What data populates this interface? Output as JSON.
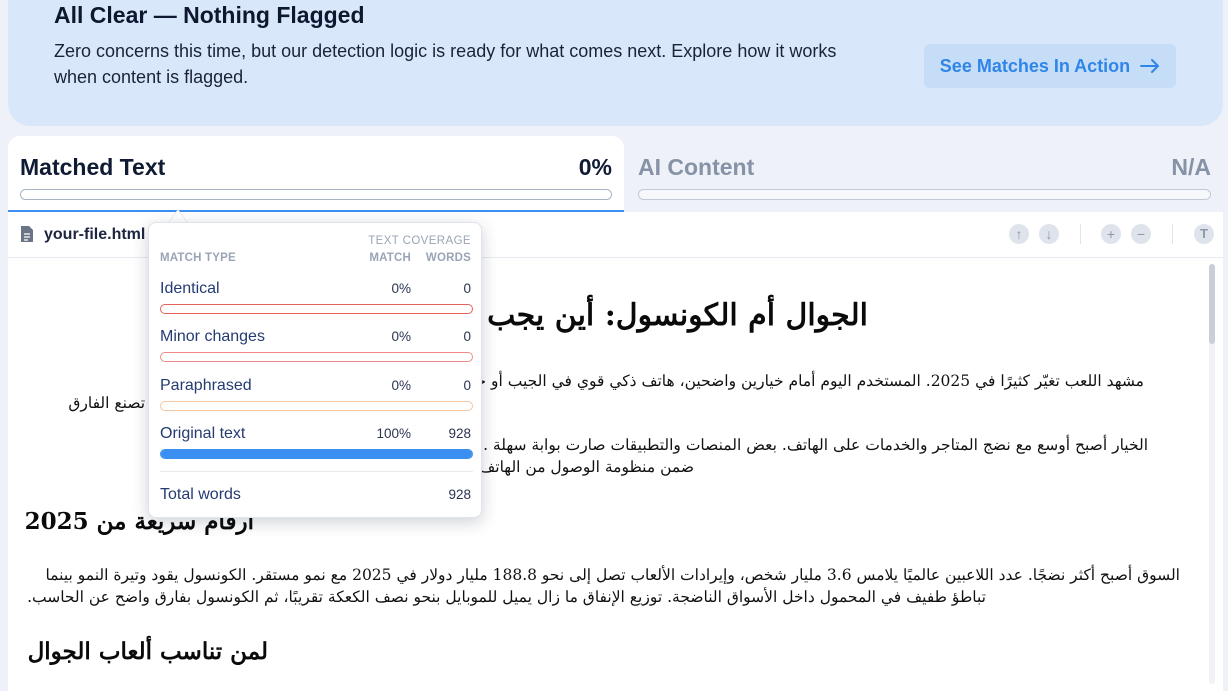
{
  "banner": {
    "title": "All Clear — Nothing Flagged",
    "text": "Zero concerns this time, but our detection logic is ready for what comes next. Explore how it works when content is flagged.",
    "button_label": "See Matches In Action",
    "button_icon": "arrow-right-icon"
  },
  "tabs": [
    {
      "label": "Matched Text",
      "value": "0%",
      "active": true
    },
    {
      "label": "AI Content",
      "value": "N/A",
      "active": false
    }
  ],
  "file": {
    "name": "your-file.html",
    "icon": "document-icon"
  },
  "toolbar": {
    "up_icon": "arrow-up-icon",
    "down_icon": "arrow-down-icon",
    "zoom_in_icon": "plus-icon",
    "zoom_out_icon": "minus-icon",
    "text_icon": "text-size-icon"
  },
  "document": {
    "h1": "الجوال أم الكونسول: أين يجب ... 2025؟",
    "p1_line1": "مشهد اللعب تغيّر كثيرًا في 2025. المستخدم اليوم أمام خيارين واضحين، هاتف ذكي قوي في الجيب أو جه ... جارب ضخمة، لكن",
    "p1_line2": "... فضلة تصنع الفارق",
    "p2_line1": "الخيار أصبح أوسع مع نضج المتاجر والخدمات على الهاتف. بعض المنصات والتطبيقات صارت بوابة سهلة ... الإلكترونية والترفيه",
    "p2_line2": "ضمن منظومة الوصول من الهاتف ... من شاشة اليد مثل",
    "h2_1": "أرقام سريعة من 2025",
    "p3_line1": "السوق أصبح أكثر نضجًا. عدد اللاعبين عالميًا يلامس 3.6 مليار شخص، وإيرادات الألعاب تصل إلى نحو 188.8 مليار دولار في 2025 مع نمو مستقر. الكونسول يقود وتيرة النمو بينما",
    "p3_line2": "تباطؤ طفيف في المحمول داخل الأسواق الناضجة. توزيع الإنفاق ما زال يميل للموبايل بنحو نصف الكعكة تقريبًا، ثم الكونسول بفارق واضح عن الحاسب.",
    "h2_2": "لمن تناسب ألعاب الجوال"
  },
  "popup": {
    "header_coverage": "TEXT COVERAGE",
    "header_match_type": "MATCH TYPE",
    "header_match": "MATCH",
    "header_words": "WORDS",
    "rows": [
      {
        "label": "Identical",
        "pct": "0%",
        "words": "0",
        "fill": 0,
        "color": "#e8605a"
      },
      {
        "label": "Minor changes",
        "pct": "0%",
        "words": "0",
        "fill": 0,
        "color": "#f08a8a"
      },
      {
        "label": "Paraphrased",
        "pct": "0%",
        "words": "0",
        "fill": 0,
        "color": "#f4c7a2"
      },
      {
        "label": "Original text",
        "pct": "100%",
        "words": "928",
        "fill": 1,
        "color": "#3b8ff0"
      }
    ],
    "total_label": "Total words",
    "total_value": "928"
  },
  "colors": {
    "accent": "#3b8ff0",
    "banner_bg": "#d8e8fa",
    "banner_button_text": "#2f86e8"
  }
}
